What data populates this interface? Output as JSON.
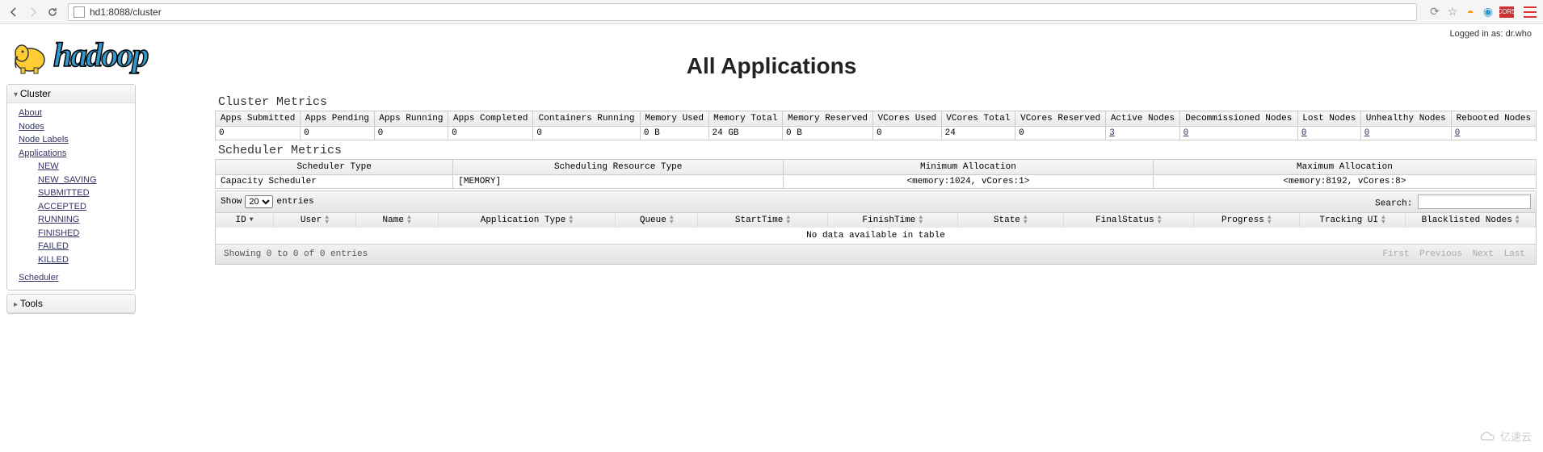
{
  "browser": {
    "url": "hd1:8088/cluster"
  },
  "login": "Logged in as: dr.who",
  "logo_text": "hadoop",
  "title": "All Applications",
  "sidebar": {
    "cluster": {
      "header": "Cluster",
      "items": [
        "About",
        "Nodes",
        "Node Labels",
        "Applications"
      ],
      "app_states": [
        "NEW",
        "NEW_SAVING",
        "SUBMITTED",
        "ACCEPTED",
        "RUNNING",
        "FINISHED",
        "FAILED",
        "KILLED"
      ],
      "scheduler": "Scheduler"
    },
    "tools_header": "Tools"
  },
  "cluster_metrics": {
    "title": "Cluster Metrics",
    "headers": [
      "Apps Submitted",
      "Apps Pending",
      "Apps Running",
      "Apps Completed",
      "Containers Running",
      "Memory Used",
      "Memory Total",
      "Memory Reserved",
      "VCores Used",
      "VCores Total",
      "VCores Reserved",
      "Active Nodes",
      "Decommissioned Nodes",
      "Lost Nodes",
      "Unhealthy Nodes",
      "Rebooted Nodes"
    ],
    "values": [
      "0",
      "0",
      "0",
      "0",
      "0",
      "0 B",
      "24 GB",
      "0 B",
      "0",
      "24",
      "0",
      "3",
      "0",
      "0",
      "0",
      "0"
    ]
  },
  "scheduler_metrics": {
    "title": "Scheduler Metrics",
    "headers": [
      "Scheduler Type",
      "Scheduling Resource Type",
      "Minimum Allocation",
      "Maximum Allocation"
    ],
    "values": [
      "Capacity Scheduler",
      "[MEMORY]",
      "<memory:1024, vCores:1>",
      "<memory:8192, vCores:8>"
    ]
  },
  "apps": {
    "show_label": "Show",
    "show_value": "20",
    "entries_label": "entries",
    "search_label": "Search:",
    "columns": [
      "ID",
      "User",
      "Name",
      "Application Type",
      "Queue",
      "StartTime",
      "FinishTime",
      "State",
      "FinalStatus",
      "Progress",
      "Tracking UI",
      "Blacklisted Nodes"
    ],
    "no_data": "No data available in table",
    "footer_info": "Showing 0 to 0 of 0 entries",
    "pager": {
      "first": "First",
      "prev": "Previous",
      "next": "Next",
      "last": "Last"
    }
  },
  "watermark": "亿速云"
}
